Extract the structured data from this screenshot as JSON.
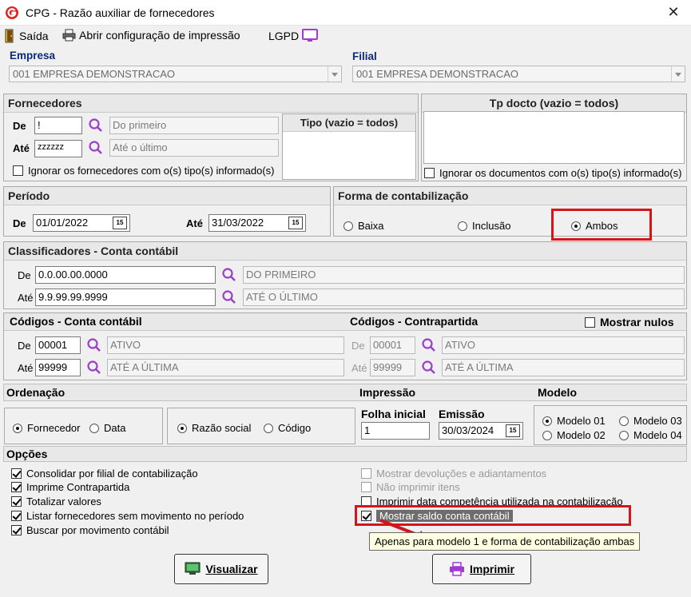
{
  "window": {
    "title": "CPG - Razão auxiliar de fornecedores",
    "close_glyph": "✕"
  },
  "menu": {
    "exit": "Saída",
    "print_config": "Abrir configuração de impressão",
    "lgpd": "LGPD"
  },
  "empresa": {
    "label": "Empresa",
    "value": "001 EMPRESA DEMONSTRACAO"
  },
  "filial": {
    "label": "Filial",
    "value": "001 EMPRESA DEMONSTRACAO"
  },
  "fornecedores": {
    "title": "Fornecedores",
    "de_label": "De",
    "de_value": "!",
    "de_desc": "Do primeiro",
    "ate_label": "Até",
    "ate_value": "zzzzzz",
    "ate_desc": "Até o último",
    "tipo_title": "Tipo (vazio = todos)",
    "ignore_label": "Ignorar os fornecedores com o(s) tipo(s) informado(s)"
  },
  "tpdocto": {
    "title": "Tp docto (vazio = todos)",
    "ignore_label": "Ignorar os documentos com o(s) tipo(s) informado(s)"
  },
  "periodo": {
    "title": "Período",
    "de_label": "De",
    "de_value": "01/01/2022",
    "ate_label": "Até",
    "ate_value": "31/03/2022",
    "cal_glyph": "15"
  },
  "contabilizacao": {
    "title": "Forma de contabilização",
    "baixa": "Baixa",
    "inclusao": "Inclusão",
    "ambos": "Ambos",
    "selected": "Ambos"
  },
  "classificadores": {
    "title": "Classificadores - Conta contábil",
    "de_label": "De",
    "de_value": "0.0.00.00.0000",
    "de_desc": "DO PRIMEIRO",
    "ate_label": "Até",
    "ate_value": "9.9.99.99.9999",
    "ate_desc": "ATÉ O ÚLTIMO"
  },
  "codigos_conta": {
    "title": "Códigos - Conta contábil",
    "de_label": "De",
    "de_value": "00001",
    "de_desc": "ATIVO",
    "ate_label": "Até",
    "ate_value": "99999",
    "ate_desc": "ATÉ A ÚLTIMA"
  },
  "codigos_contra": {
    "title": "Códigos - Contrapartida",
    "show_nulls": "Mostrar nulos",
    "de_label": "De",
    "de_value": "00001",
    "de_desc": "ATIVO",
    "ate_label": "Até",
    "ate_value": "99999",
    "ate_desc": "ATÉ A ÚLTIMA"
  },
  "ordenacao": {
    "title": "Ordenação",
    "fornecedor": "Fornecedor",
    "data": "Data",
    "razao": "Razão social",
    "codigo": "Código"
  },
  "impressao": {
    "title": "Impressão",
    "folha_label": "Folha inicial",
    "folha_value": "1",
    "emissao_label": "Emissão",
    "emissao_value": "30/03/2024"
  },
  "modelo": {
    "title": "Modelo",
    "m1": "Modelo 01",
    "m2": "Modelo 02",
    "m3": "Modelo 03",
    "m4": "Modelo 04"
  },
  "opcoes": {
    "title": "Opções",
    "left": [
      {
        "label": "Consolidar por filial de contabilização",
        "checked": true
      },
      {
        "label": "Imprime Contrapartida",
        "checked": true
      },
      {
        "label": "Totalizar valores",
        "checked": true
      },
      {
        "label": "Listar fornecedores sem movimento no período",
        "checked": true
      },
      {
        "label": "Buscar por movimento contábil",
        "checked": true
      }
    ],
    "right": [
      {
        "label": "Mostrar devoluções e adiantamentos",
        "checked": false,
        "enabled": false
      },
      {
        "label": "Não imprimir itens",
        "checked": false,
        "enabled": false
      },
      {
        "label": "Imprimir data competência utilizada na contabilização",
        "checked": false,
        "enabled": true
      },
      {
        "label": "Mostrar saldo conta contábil",
        "checked": true,
        "enabled": true
      }
    ]
  },
  "tooltip": "Apenas para modelo 1 e forma de contabilização ambas",
  "buttons": {
    "visualizar": "Visualizar",
    "imprimir": "Imprimir"
  },
  "colors": {
    "highlight": "#d6151b",
    "search_icon": "#9b3fc6",
    "label_blue": "#0a2a7a"
  }
}
